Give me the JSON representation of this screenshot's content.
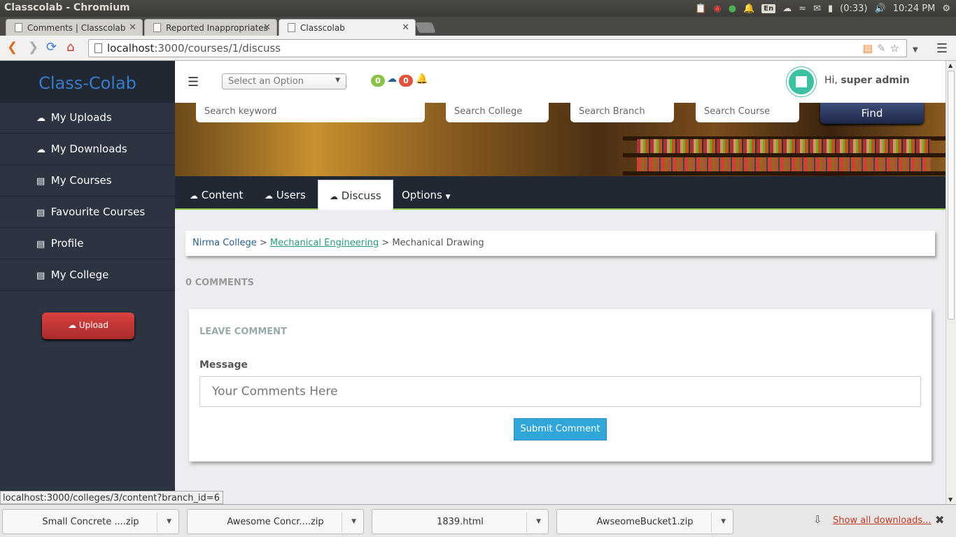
{
  "os": {
    "window_title": "Classcolab - Chromium",
    "lang": "En",
    "battery": "(0:33)",
    "clock": "10:24 PM"
  },
  "browser": {
    "tabs": [
      {
        "label": "Comments | Classcolab",
        "active": false
      },
      {
        "label": "Reported Inappropriates",
        "active": false
      },
      {
        "label": "Classcolab",
        "active": true
      }
    ],
    "url_host": "localhost",
    "url_path": ":3000/courses/1/discuss",
    "status_url": "localhost:3000/colleges/3/content?branch_id=6"
  },
  "sidebar": {
    "brand": "Class-Colab",
    "items": [
      {
        "label": "My Uploads",
        "icon": "cloud-upload-icon"
      },
      {
        "label": "My Downloads",
        "icon": "cloud-download-icon"
      },
      {
        "label": "My Courses",
        "icon": "book-icon"
      },
      {
        "label": "Favourite Courses",
        "icon": "book-icon"
      },
      {
        "label": "Profile",
        "icon": "book-icon"
      },
      {
        "label": "My College",
        "icon": "book-icon"
      }
    ],
    "upload_label": "Upload"
  },
  "header": {
    "select_placeholder": "Select an Option",
    "badge_uploads": "0",
    "badge_downloads": "0",
    "greeting_prefix": "Hi, ",
    "user_name": "super admin"
  },
  "search": {
    "keyword_placeholder": "Search keyword",
    "college_placeholder": "Search College",
    "branch_placeholder": "Search Branch",
    "course_placeholder": "Search Course",
    "find_label": "Find"
  },
  "course_tabs": [
    {
      "label": "Content",
      "active": false
    },
    {
      "label": "Users",
      "active": false
    },
    {
      "label": "Discuss",
      "active": true
    },
    {
      "label": "Options",
      "active": false
    }
  ],
  "breadcrumb": {
    "college": "Nirma College",
    "sep": " > ",
    "branch": "Mechanical Engineering",
    "course": "Mechanical Drawing"
  },
  "comments": {
    "count_label": "0 COMMENTS",
    "leave_heading": "LEAVE COMMENT",
    "message_label": "Message",
    "message_placeholder": "Your Comments Here",
    "submit_label": "Submit Comment"
  },
  "downloads": {
    "items": [
      "Small Concrete ....zip",
      "Awesome Concr....zip",
      "1839.html",
      "AwseomeBucket1.zip"
    ],
    "show_all": "Show all downloads..."
  },
  "colors": {
    "sidebar_bg": "#2b3440",
    "brand_blue": "#3a7bc8",
    "upload_red": "#c33a37",
    "submit_blue": "#31a6d8",
    "badge_green": "#8bc34a",
    "badge_red": "#e0533d"
  }
}
